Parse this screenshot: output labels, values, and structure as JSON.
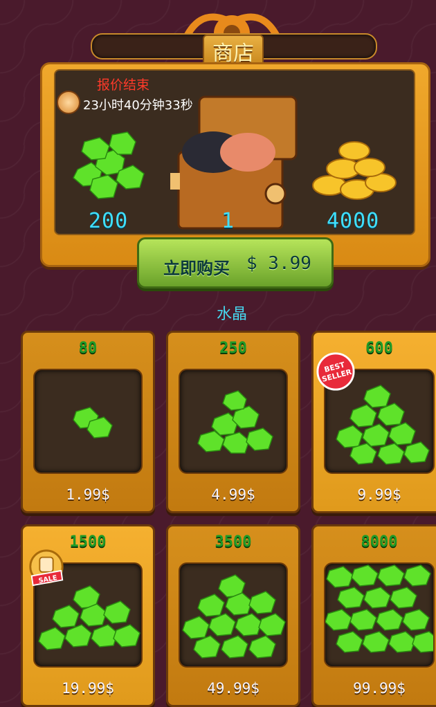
{
  "header": {
    "title": "商店"
  },
  "offer": {
    "expired_label": "报价结束",
    "timer": "23小时40分钟33秒",
    "gem_amount": "200",
    "chest_amount": "1",
    "coin_amount": "4000",
    "buy_label": "立即购买",
    "buy_price": "$ 3.99"
  },
  "section": {
    "title": "水晶"
  },
  "packs": [
    {
      "qty": "80",
      "price": "1.99$"
    },
    {
      "qty": "250",
      "price": "4.99$"
    },
    {
      "qty": "600",
      "price": "9.99$",
      "badge": "BEST SELLER"
    },
    {
      "qty": "1500",
      "price": "19.99$",
      "badge": "SALE"
    },
    {
      "qty": "3500",
      "price": "49.99$"
    },
    {
      "qty": "8000",
      "price": "99.99$"
    }
  ],
  "colors": {
    "accent": "#f0a82c",
    "gem": "#5fe22a",
    "number": "#3fe0ff",
    "buy": "#8cc63f"
  }
}
